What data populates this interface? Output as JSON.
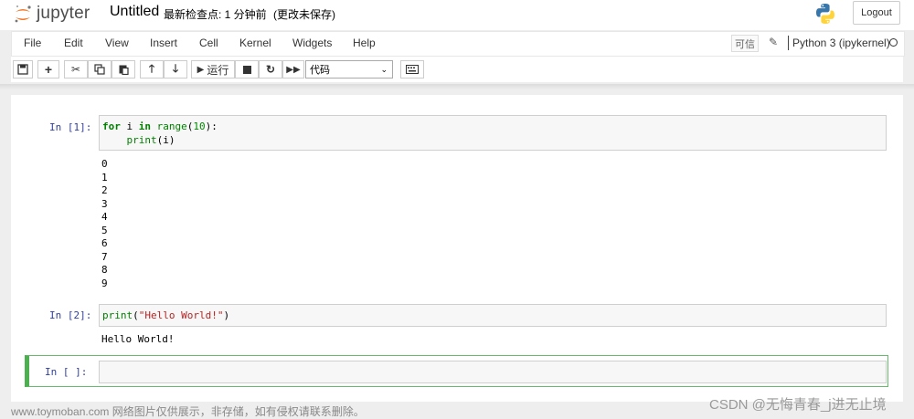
{
  "header": {
    "logo_text": "jupyter",
    "notebook_name": "Untitled",
    "checkpoint": "最新检查点: 1 分钟前",
    "autosave": "(更改未保存)",
    "logout_label": "Logout"
  },
  "menu": {
    "items": [
      "File",
      "Edit",
      "View",
      "Insert",
      "Cell",
      "Kernel",
      "Widgets",
      "Help"
    ],
    "trusted_label": "可信",
    "kernel_name": "Python 3 (ipykernel)"
  },
  "toolbar": {
    "run_label": "运行",
    "cell_type": "代码"
  },
  "cells": [
    {
      "prompt": "In  [1]:",
      "code": [
        "for i in range(10):",
        "    print(i)"
      ],
      "output": [
        "0",
        "1",
        "2",
        "3",
        "4",
        "5",
        "6",
        "7",
        "8",
        "9"
      ]
    },
    {
      "prompt": "In  [2]:",
      "code": [
        "print(\"Hello World!\")"
      ],
      "output": [
        "Hello World!"
      ]
    },
    {
      "prompt": "In  [ ]:",
      "code": [],
      "output": []
    }
  ],
  "watermarks": {
    "left": "www.toymoban.com 网络图片仅供展示，非存储，如有侵权请联系删除。",
    "right": "CSDN @无悔青春_j进无止境"
  },
  "colors": {
    "prompt_blue": "#303f9f",
    "keyword_green": "#008000",
    "string_red": "#ba2121",
    "active_cell_green": "#4caf50"
  }
}
